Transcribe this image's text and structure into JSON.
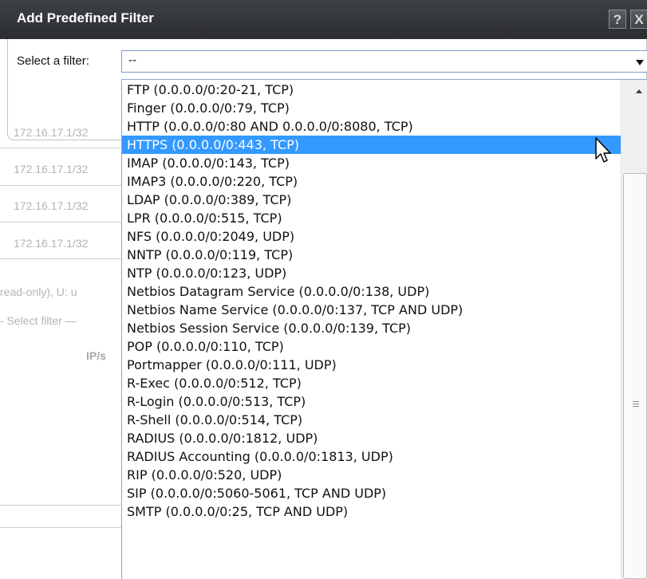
{
  "dialog": {
    "title": "Add Predefined Filter",
    "help_label": "?",
    "close_label": "X"
  },
  "filter_select": {
    "label": "Select a filter:",
    "value": "--"
  },
  "background": {
    "ip_rows": [
      "172.16.17.1/32",
      "172.16.17.1/32",
      "172.16.17.1/32",
      "172.16.17.1/32"
    ],
    "legend": "read-only), U: u",
    "select_filter": "- Select filter —",
    "ip_header": "IP/s"
  },
  "dropdown": {
    "options": [
      "FTP (0.0.0.0/0:20-21, TCP)",
      "Finger (0.0.0.0/0:79, TCP)",
      "HTTP (0.0.0.0/0:80 AND 0.0.0.0/0:8080, TCP)",
      "HTTPS (0.0.0.0/0:443, TCP)",
      "IMAP (0.0.0.0/0:143, TCP)",
      "IMAP3 (0.0.0.0/0:220, TCP)",
      "LDAP (0.0.0.0/0:389, TCP)",
      "LPR (0.0.0.0/0:515, TCP)",
      "NFS (0.0.0.0/0:2049, UDP)",
      "NNTP (0.0.0.0/0:119, TCP)",
      "NTP (0.0.0.0/0:123, UDP)",
      "Netbios Datagram Service (0.0.0.0/0:138, UDP)",
      "Netbios Name Service (0.0.0.0/0:137, TCP AND UDP)",
      "Netbios Session Service (0.0.0.0/0:139, TCP)",
      "POP (0.0.0.0/0:110, TCP)",
      "Portmapper (0.0.0.0/0:111, UDP)",
      "R-Exec (0.0.0.0/0:512, TCP)",
      "R-Login (0.0.0.0/0:513, TCP)",
      "R-Shell (0.0.0.0/0:514, TCP)",
      "RADIUS (0.0.0.0/0:1812, UDP)",
      "RADIUS Accounting (0.0.0.0/0:1813, UDP)",
      "RIP (0.0.0.0/0:520, UDP)",
      "SIP (0.0.0.0/0:5060-5061, TCP AND UDP)",
      "SMTP (0.0.0.0/0:25, TCP AND UDP)"
    ],
    "highlighted": "HTTPS (0.0.0.0/0:443, TCP)"
  },
  "colors": {
    "titlebar": "#2b2d31",
    "highlight": "#3399ff",
    "faded_text": "#b3b3b3"
  },
  "icons": {
    "help": "question-mark-icon",
    "close": "close-icon",
    "dropdown_arrow": "chevron-down-icon",
    "scroll_up": "scroll-up-arrow-icon",
    "cursor": "mouse-pointer-icon"
  }
}
